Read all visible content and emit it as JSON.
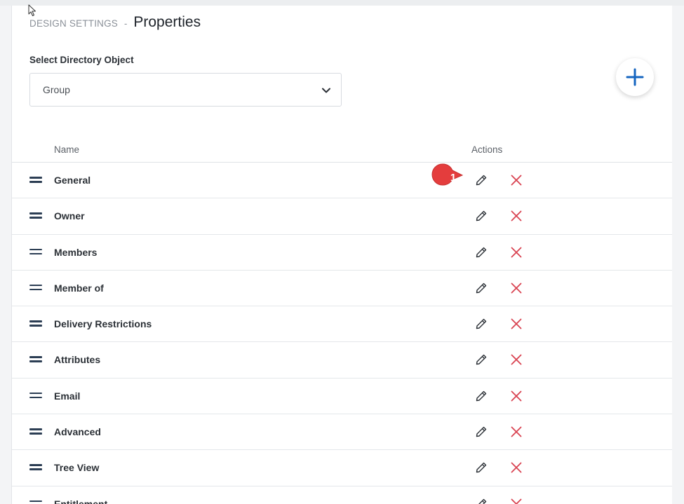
{
  "breadcrumb": {
    "parent": "DESIGN SETTINGS",
    "separator": "-",
    "current": "Properties"
  },
  "select": {
    "label": "Select Directory Object",
    "value": "Group"
  },
  "table": {
    "columns": {
      "name": "Name",
      "actions": "Actions"
    },
    "rows": [
      {
        "name": "General"
      },
      {
        "name": "Owner"
      },
      {
        "name": "Members"
      },
      {
        "name": "Member of"
      },
      {
        "name": "Delivery Restrictions"
      },
      {
        "name": "Attributes"
      },
      {
        "name": "Email"
      },
      {
        "name": "Advanced"
      },
      {
        "name": "Tree View"
      },
      {
        "name": "Entitlement"
      }
    ]
  },
  "callout": {
    "number": "1"
  },
  "icons": {
    "add": "plus-icon",
    "edit": "pencil-icon",
    "delete": "close-x-icon",
    "drag": "drag-handle-icon",
    "dropdown": "chevron-down-icon"
  },
  "colors": {
    "accent_blue": "#1565c0",
    "delete_red": "#d94452",
    "callout_red": "#e43d3d",
    "drag_navy": "#2c3e54"
  }
}
